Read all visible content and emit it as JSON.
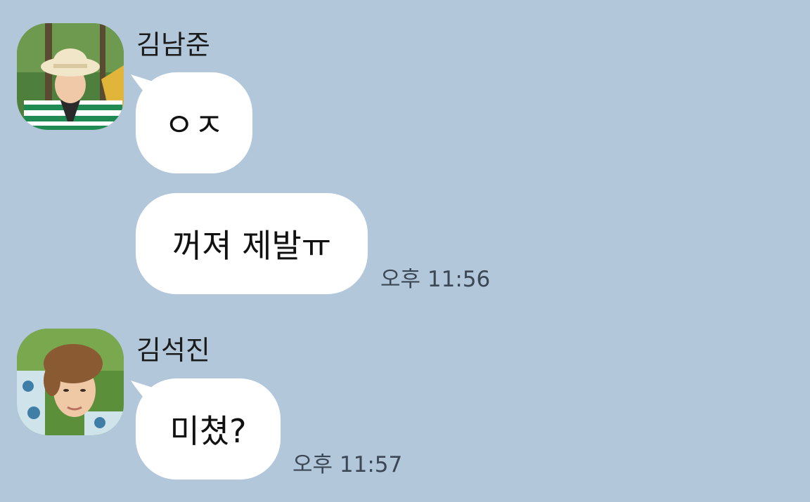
{
  "conversation": {
    "background_color": "#b2c7da",
    "messages": [
      {
        "sender": "김남준",
        "bubbles": [
          {
            "text": "ㅇㅈ",
            "time": ""
          },
          {
            "text": "꺼져 제발ㅠ",
            "time": "오후 11:56"
          }
        ]
      },
      {
        "sender": "김석진",
        "bubbles": [
          {
            "text": "미쳤?",
            "time": "오후 11:57"
          }
        ]
      }
    ]
  }
}
